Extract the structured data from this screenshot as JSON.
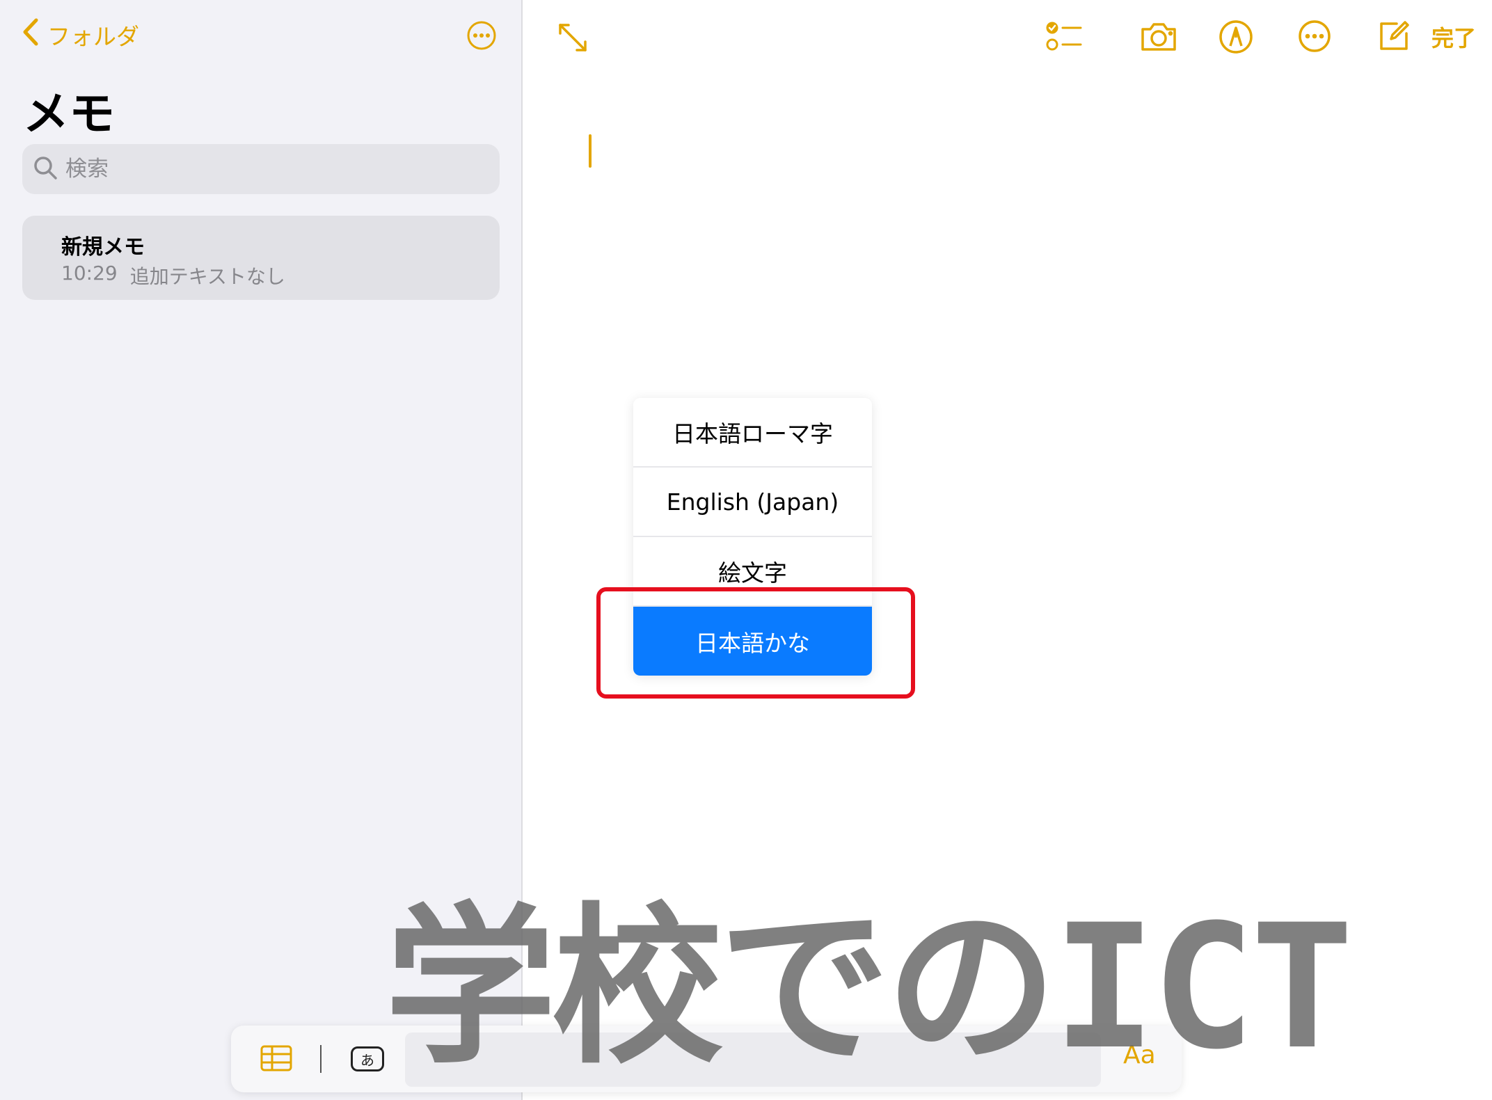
{
  "sidebar": {
    "back_label": "フォルダ",
    "title": "メモ",
    "search_placeholder": "検索",
    "notes": [
      {
        "title": "新規メモ",
        "time": "10:29",
        "preview": "追加テキストなし"
      }
    ]
  },
  "toolbar": {
    "icons": [
      "expand-icon",
      "checklist-icon",
      "camera-icon",
      "markup-pen-icon",
      "more-icon",
      "compose-icon"
    ],
    "done_label": "完了"
  },
  "language_menu": {
    "items": [
      "日本語ローマ字",
      "English (Japan)",
      "絵文字",
      "日本語かな"
    ],
    "selected": "日本語かな"
  },
  "bottom_bar": {
    "keyboard_key_label": "あ",
    "format_label": "Aa"
  },
  "watermark": "学校でのICT",
  "colors": {
    "accent": "#e3a600",
    "selected_blue": "#0a7bff",
    "highlight_red": "#e60f1e",
    "sidebar_bg": "#f2f2f7"
  }
}
